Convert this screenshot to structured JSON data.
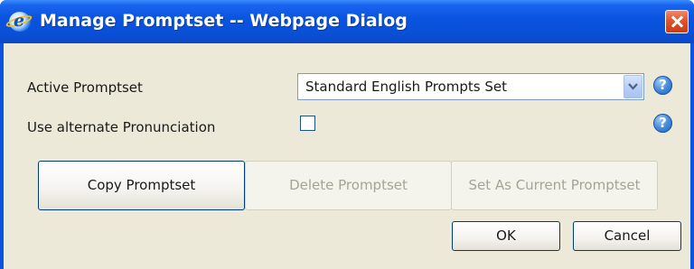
{
  "window": {
    "title": "Manage Promptset -- Webpage Dialog"
  },
  "form": {
    "active_promptset_label": "Active Promptset",
    "active_promptset_value": "Standard English Prompts Set",
    "alternate_pronunciation_label": "Use alternate Pronunciation",
    "alternate_pronunciation_checked": false
  },
  "help": {
    "glyph": "?"
  },
  "buttons": {
    "copy": "Copy Promptset",
    "delete": "Delete Promptset",
    "set_current": "Set As Current Promptset",
    "ok": "OK",
    "cancel": "Cancel"
  },
  "icons": {
    "app": "ie-icon",
    "close": "close-icon",
    "dropdown": "chevron-down-icon",
    "help": "help-icon"
  },
  "colors": {
    "titlebar": "#0a54e0",
    "close_button": "#e2542c",
    "dialog_background": "#ece9d8"
  }
}
